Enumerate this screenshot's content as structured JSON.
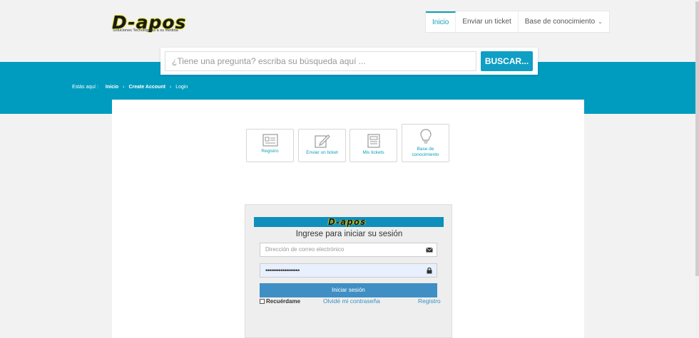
{
  "logo": {
    "text": "D-apos",
    "tagline": "Soluciones Tecnológicas a su medida"
  },
  "nav": {
    "items": [
      {
        "label": "Inicio"
      },
      {
        "label": "Enviar un ticket"
      },
      {
        "label": "Base de conocimiento"
      }
    ]
  },
  "search": {
    "placeholder": "¿Tiene una pregunta? escriba su búsqueda aquí ...",
    "button": "BUSCAR..."
  },
  "breadcrumb": {
    "prefix": "Estás aquí :",
    "items": [
      "Inicio",
      "Create Account",
      "Login"
    ]
  },
  "tiles": [
    {
      "label": "Registro",
      "icon": "id-card-icon"
    },
    {
      "label": "Enviar un ticket",
      "icon": "edit-icon"
    },
    {
      "label": "Mis tickets",
      "icon": "ticket-list-icon"
    },
    {
      "label": "Base de conocimiento",
      "icon": "lightbulb-icon"
    }
  ],
  "login": {
    "brand": "D-apos",
    "title": "Ingrese para iniciar su sesión",
    "email_placeholder": "Dirección de correo electrónico",
    "password_value": "••••••••••••••••••",
    "submit": "Iniciar sesión",
    "remember": "Recuérdame",
    "forgot": "Olvidé mi contraseña",
    "register": "Registro"
  },
  "colors": {
    "accent": "#009cbf",
    "button": "#0f9fc4",
    "login_header": "#0f8fbb",
    "link": "#3a8fbf"
  }
}
